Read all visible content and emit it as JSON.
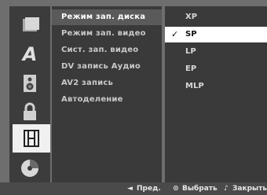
{
  "icons": [
    {
      "name": "disc-box-icon"
    },
    {
      "name": "language-a-icon"
    },
    {
      "name": "speaker-icon"
    },
    {
      "name": "lock-icon"
    },
    {
      "name": "film-frame-icon"
    },
    {
      "name": "dvd-disc-icon"
    }
  ],
  "menu": {
    "items": [
      {
        "label": "Режим зап. диска"
      },
      {
        "label": "Режим зап. видео"
      },
      {
        "label": "Сист. зап. видео"
      },
      {
        "label": "DV запись Аудио"
      },
      {
        "label": "AV2 запись"
      },
      {
        "label": "Автоделение"
      }
    ],
    "selected_index": 0
  },
  "options": {
    "items": [
      {
        "label": "XP"
      },
      {
        "label": "SP"
      },
      {
        "label": "LP"
      },
      {
        "label": "EP"
      },
      {
        "label": "MLP"
      }
    ],
    "selected_index": 1,
    "check_mark": "✓"
  },
  "footer": {
    "prev_glyph": "◄",
    "prev_label": "Пред.",
    "select_glyph": "⊙",
    "select_label": "Выбрать",
    "close_glyph": "♪",
    "close_label": "Закрыть"
  }
}
